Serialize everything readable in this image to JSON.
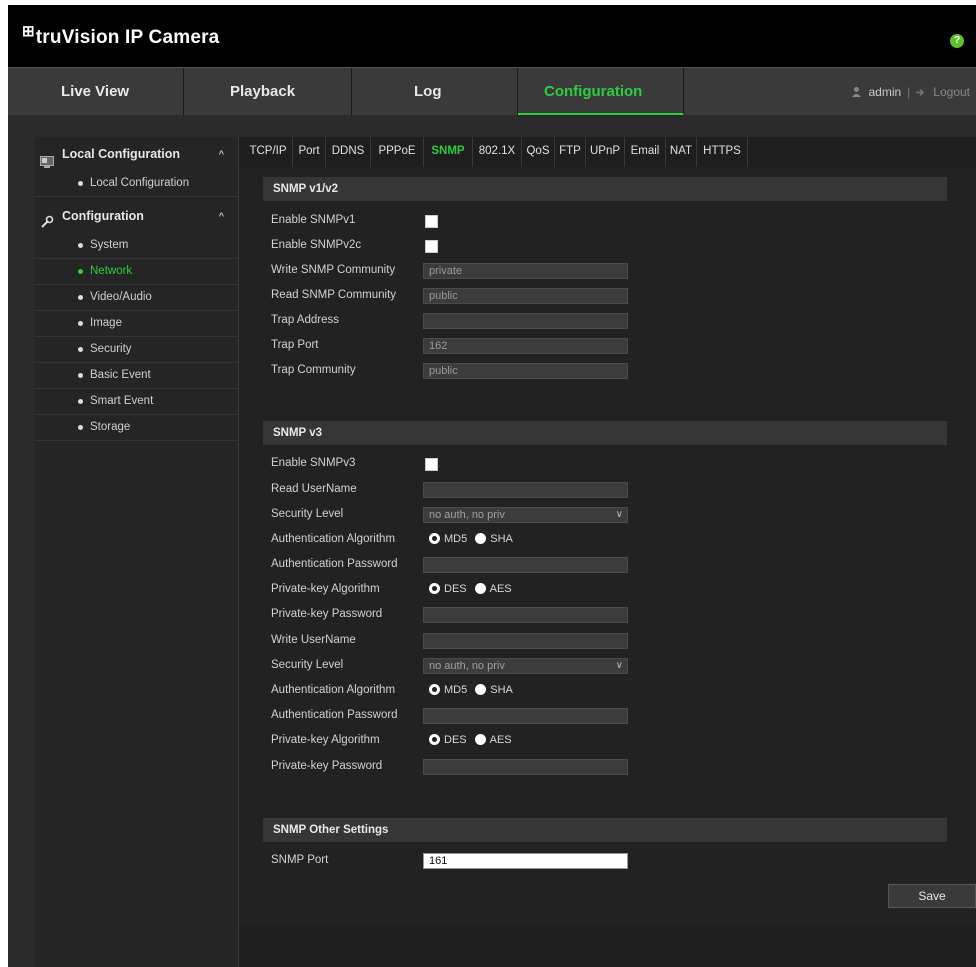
{
  "app": {
    "title": "truVision IP Camera",
    "logo_mark": "⊞"
  },
  "nav": {
    "tabs": [
      {
        "label": "Live View"
      },
      {
        "label": "Playback"
      },
      {
        "label": "Log"
      },
      {
        "label": "Configuration"
      }
    ],
    "active_tab": "Configuration",
    "user": "admin",
    "logout": "Logout",
    "help": "?"
  },
  "sidebar": {
    "local_header": "Local Configuration",
    "local_items": [
      "Local Configuration"
    ],
    "config_header": "Configuration",
    "config_items": [
      "System",
      "Network",
      "Video/Audio",
      "Image",
      "Security",
      "Basic Event",
      "Smart Event",
      "Storage"
    ],
    "active_item": "Network",
    "caret": "^"
  },
  "subtabs": [
    "TCP/IP",
    "Port",
    "DDNS",
    "PPPoE",
    "SNMP",
    "802.1X",
    "QoS",
    "FTP",
    "UPnP",
    "Email",
    "NAT",
    "HTTPS"
  ],
  "active_subtab": "SNMP",
  "snmp_v1v2": {
    "title": "SNMP v1/v2",
    "enable_v1_label": "Enable SNMPv1",
    "enable_v1": false,
    "enable_v2c_label": "Enable SNMPv2c",
    "enable_v2c": false,
    "write_community_label": "Write SNMP Community",
    "write_community": "private",
    "read_community_label": "Read SNMP Community",
    "read_community": "public",
    "trap_address_label": "Trap Address",
    "trap_address": "",
    "trap_port_label": "Trap Port",
    "trap_port": "162",
    "trap_community_label": "Trap Community",
    "trap_community": "public"
  },
  "snmp_v3": {
    "title": "SNMP v3",
    "enable_v3_label": "Enable SNMPv3",
    "enable_v3": false,
    "read_username_label": "Read UserName",
    "read_username": "",
    "security_level_label": "Security Level",
    "read_security_level": "no auth, no priv",
    "auth_algo_label": "Authentication Algorithm",
    "auth_opt_1": "MD5",
    "auth_opt_2": "SHA",
    "auth_password_label": "Authentication Password",
    "privkey_algo_label": "Private-key Algorithm",
    "priv_opt_1": "DES",
    "priv_opt_2": "AES",
    "privkey_password_label": "Private-key Password",
    "write_username_label": "Write UserName",
    "write_username": "",
    "write_security_level": "no auth, no priv",
    "chevron": "∨"
  },
  "snmp_other": {
    "title": "SNMP Other Settings",
    "port_label": "SNMP Port",
    "port": "161"
  },
  "save_label": "Save",
  "colors": {
    "accent": "#2ecc40",
    "background": "#2b2b2b",
    "topbar": "#000000"
  }
}
